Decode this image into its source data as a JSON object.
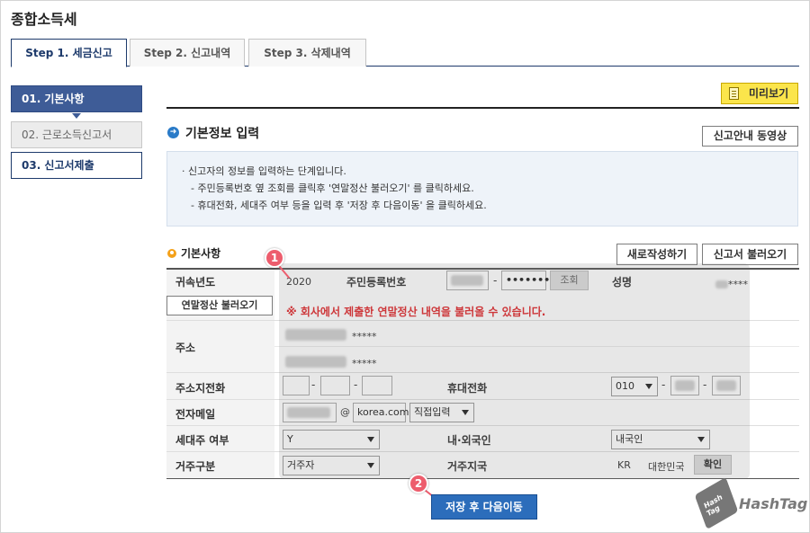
{
  "app": {
    "title": "종합소득세"
  },
  "tabs": [
    {
      "label": "Step 1. 세금신고"
    },
    {
      "label": "Step 2. 신고내역"
    },
    {
      "label": "Step 3. 삭제내역"
    }
  ],
  "steps": [
    {
      "label": "01. 기본사항"
    },
    {
      "label": "02. 근로소득신고서"
    },
    {
      "label": "03. 신고서제출"
    }
  ],
  "toolbar": {
    "preview_label": "미리보기"
  },
  "section": {
    "title": "기본정보 입력",
    "guide_button": "신고안내 동영상",
    "info_lines": [
      "· 신고자의 정보를 입력하는 단계입니다.",
      "- 주민등록번호 옆 조회를 클릭후 '연말정산 불러오기' 를 클릭하세요.",
      "- 휴대전화, 세대주 여부 등을 입력 후 '저장 후 다음이동' 을 클릭하세요."
    ]
  },
  "basic": {
    "title": "기본사항",
    "new_button": "새로작성하기",
    "load_button": "신고서 불러오기"
  },
  "form": {
    "year_label": "귀속년도",
    "year_value": "2020",
    "rrn_label": "주민등록번호",
    "rrn_masked": "•••••••",
    "lookup_button": "조회",
    "name_label": "성명",
    "name_masked": "****",
    "yearend_button": "연말정산 불러오기",
    "warning": "※ 회사에서 제출한 연말정산 내역을 불러올 수 있습니다.",
    "address_label": "주소",
    "address_masked_1": "*****",
    "address_masked_2": "*****",
    "phone_label": "주소지전화",
    "mobile_label": "휴대전화",
    "mobile_prefix": "010",
    "email_label": "전자메일",
    "email_at": "@",
    "email_domain": "korea.com",
    "email_select": "직접입력",
    "household_label": "세대주 여부",
    "household_value": "Y",
    "nationality_label": "내·외국인",
    "nationality_value": "내국인",
    "residence_label": "거주구분",
    "residence_value": "거주자",
    "country_label": "거주지국",
    "country_code": "KR",
    "country_name": "대한민국",
    "confirm_button": "확인",
    "dash": "-"
  },
  "save_button": "저장 후 다음이동",
  "callouts": [
    "1",
    "2"
  ],
  "watermark": {
    "cube_text": "Hash Tag",
    "text": "HashTag"
  },
  "colors": {
    "primary": "#2c6dbb",
    "step_active": "#3e5c97",
    "warning": "#e0292d",
    "badge": "#ed5d6d",
    "preview": "#fbe54b"
  }
}
